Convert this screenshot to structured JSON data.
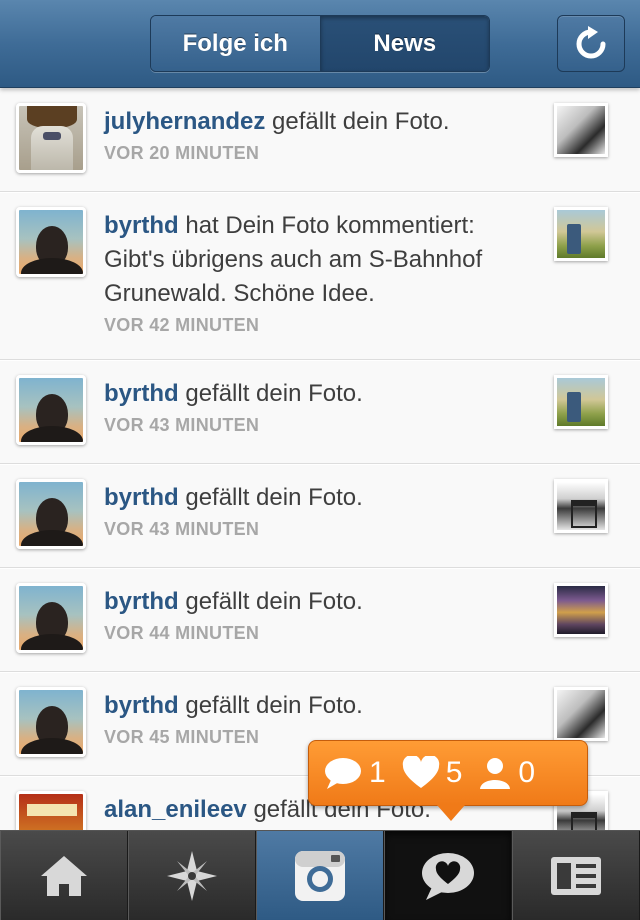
{
  "header": {
    "tabs": [
      {
        "label": "Folge ich",
        "active": false
      },
      {
        "label": "News",
        "active": true
      }
    ],
    "refresh_icon": "refresh-icon"
  },
  "feed": [
    {
      "user": "julyhernandez",
      "action": "gefällt dein Foto.",
      "time": "VOR 20 MINUTEN",
      "avatar": "julyhernandez"
    },
    {
      "user": "byrthd",
      "action": "hat Dein Foto kommentiert:",
      "comment": "Gibt's übrigens auch am S-Bahnhof Grunewald. Schöne Idee.",
      "time": "VOR 42 MINUTEN",
      "avatar": "byrthd"
    },
    {
      "user": "byrthd",
      "action": "gefällt dein Foto.",
      "time": "VOR 43 MINUTEN",
      "avatar": "byrthd"
    },
    {
      "user": "byrthd",
      "action": "gefällt dein Foto.",
      "time": "VOR 43 MINUTEN",
      "avatar": "byrthd"
    },
    {
      "user": "byrthd",
      "action": "gefällt dein Foto.",
      "time": "VOR 44 MINUTEN",
      "avatar": "byrthd"
    },
    {
      "user": "byrthd",
      "action": "gefällt dein Foto.",
      "time": "VOR 45 MINUTEN",
      "avatar": "byrthd"
    },
    {
      "user": "alan_enileev",
      "action": "gefällt dein Foto.",
      "avatar": "alan_enileev"
    }
  ],
  "notification": {
    "comments": "1",
    "likes": "5",
    "followers": "0"
  },
  "tabbar": {
    "items": [
      "home-icon",
      "explore-icon",
      "camera-icon",
      "activity-icon",
      "profile-icon"
    ],
    "active": "activity-icon"
  },
  "colors": {
    "header_blue": "#3f6c97",
    "username_blue": "#2b5784",
    "time_gray": "#a7a7a7",
    "badge_orange": "#f07a18"
  }
}
